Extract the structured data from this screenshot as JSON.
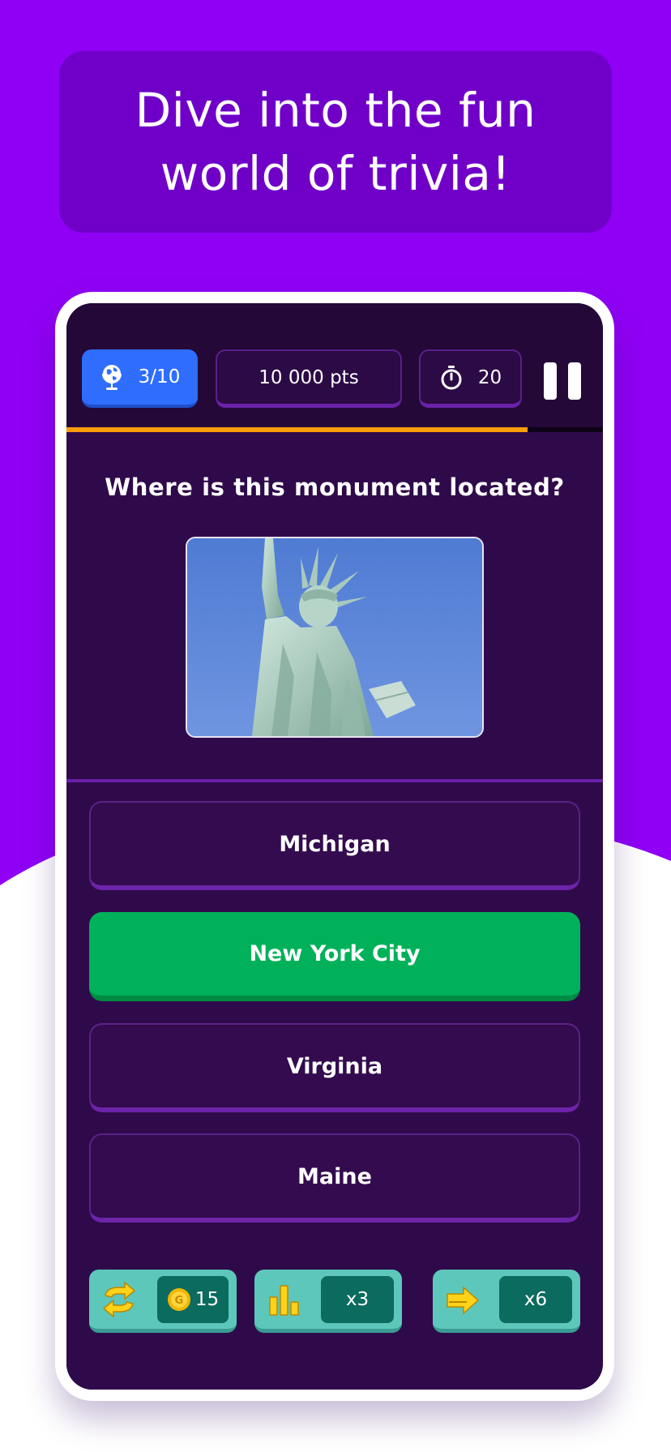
{
  "banner": {
    "headline": "Dive into the fun world of trivia!"
  },
  "status_bar": {
    "level": "3/10",
    "points": "10 000 pts",
    "timer": "20",
    "progress_fraction": 0.86
  },
  "question": {
    "text": "Where is this monument located?",
    "image_subject": "Statue of Liberty"
  },
  "answers": [
    {
      "label": "Michigan",
      "state": "normal"
    },
    {
      "label": "New York City",
      "state": "correct"
    },
    {
      "label": "Virginia",
      "state": "normal"
    },
    {
      "label": "Maine",
      "state": "normal"
    }
  ],
  "powerups": [
    {
      "icon": "swap-arrows-icon",
      "value": "15",
      "cost_icon": "gold-coin-icon"
    },
    {
      "icon": "bar-chart-icon",
      "value": "x3"
    },
    {
      "icon": "skip-arrow-icon",
      "value": "x6"
    }
  ],
  "colors": {
    "background_purple": "#8f00f5",
    "banner": "#7000c8",
    "level_chip": "#2f6dff",
    "correct": "#00b15a",
    "progress": "#ff9d0a",
    "powerup": "#5ec7bb"
  }
}
